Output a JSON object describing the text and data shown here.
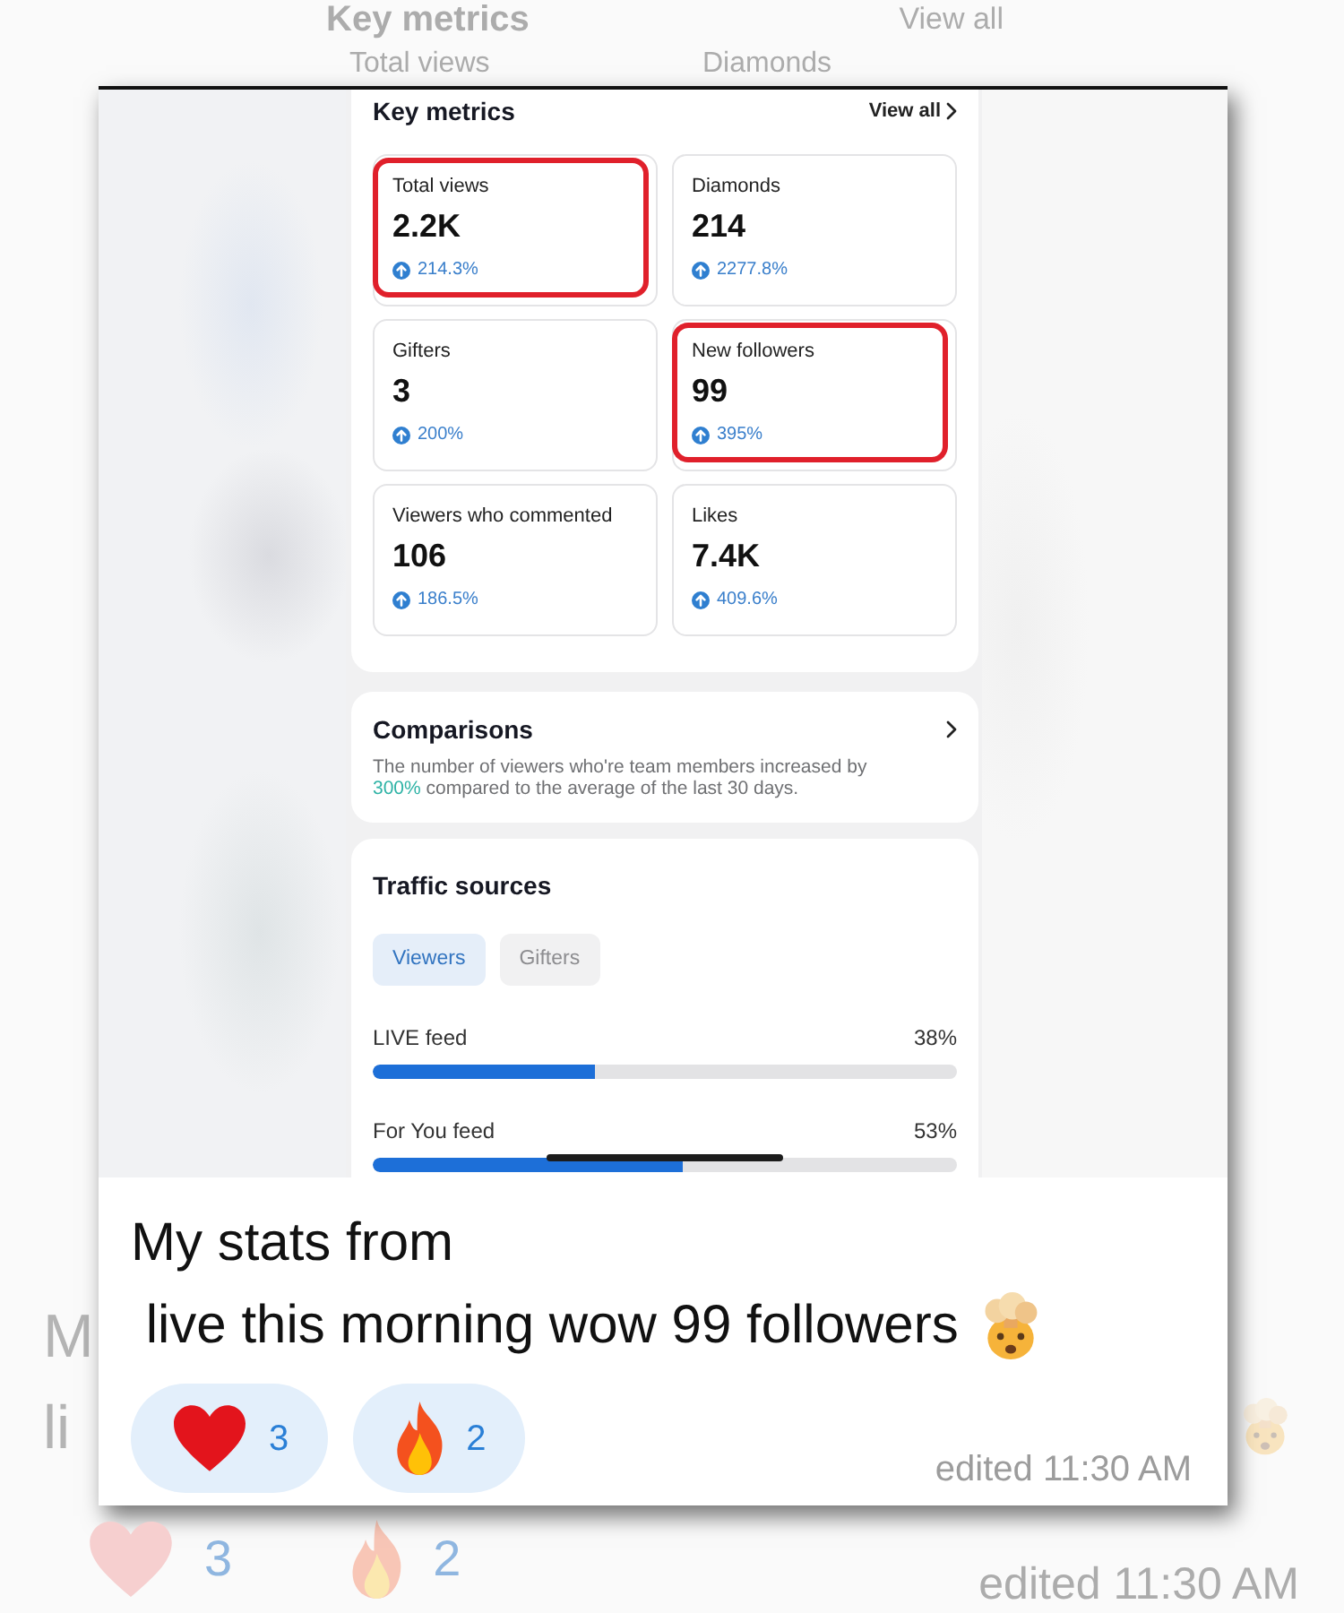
{
  "backdrop_top": {
    "title": "Key metrics",
    "link": "View all",
    "metric_labels": [
      "Total views",
      "Diamonds"
    ]
  },
  "screenshot": {
    "key_metrics": {
      "title": "Key metrics",
      "link": "View all",
      "metrics": [
        {
          "label": "Total views",
          "value": "2.2K",
          "change": "214.3%",
          "highlighted": true
        },
        {
          "label": "Diamonds",
          "value": "214",
          "change": "2277.8%",
          "highlighted": false
        },
        {
          "label": "Gifters",
          "value": "3",
          "change": "200%",
          "highlighted": false
        },
        {
          "label": "New followers",
          "value": "99",
          "change": "395%",
          "highlighted": true
        },
        {
          "label": "Viewers who commented",
          "value": "106",
          "change": "186.5%",
          "highlighted": false
        },
        {
          "label": "Likes",
          "value": "7.4K",
          "change": "409.6%",
          "highlighted": false
        }
      ]
    },
    "comparisons": {
      "title": "Comparisons",
      "description": [
        {
          "text": "The number of viewers who're team members increased by ",
          "emphasis": false
        },
        {
          "text": "300%",
          "emphasis": true
        },
        {
          "text": " compared to the average of the last 30 days.",
          "emphasis": false
        }
      ]
    },
    "traffic_sources": {
      "title": "Traffic sources",
      "tabs": [
        {
          "label": "Viewers",
          "selected": true
        },
        {
          "label": "Gifters",
          "selected": false
        }
      ],
      "sources": [
        {
          "name": "LIVE feed",
          "share": "38%",
          "level": 0.38
        },
        {
          "name": "For You feed",
          "share": "53%",
          "level": 0.53
        }
      ]
    }
  },
  "message": {
    "text": "My stats from\n live this morning wow 99 followers",
    "reactions": [
      {
        "kind": "heart",
        "count": "3"
      },
      {
        "kind": "fire",
        "count": "2"
      }
    ],
    "edited_time": "edited 11:30 AM"
  },
  "backdrop_bottom": {
    "message_fragments": [
      "M",
      "li"
    ],
    "reactions": [
      {
        "kind": "heart",
        "count": "3"
      },
      {
        "kind": "fire",
        "count": "2"
      }
    ],
    "edited_time": "edited 11:30 AM"
  }
}
